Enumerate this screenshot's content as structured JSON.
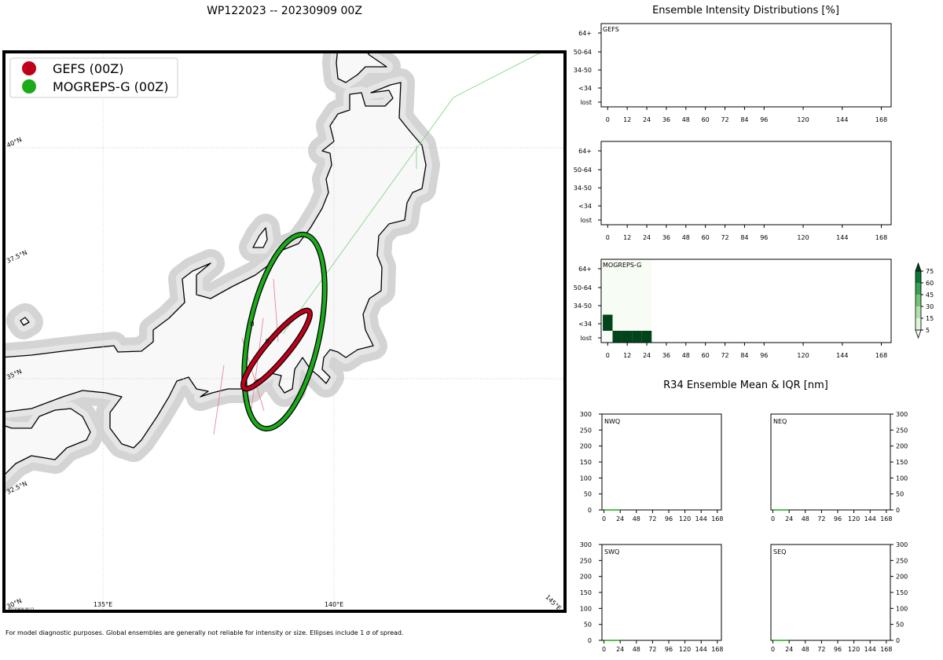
{
  "map": {
    "title": "WP122023 -- 20230909 00Z",
    "legend": [
      {
        "label": "GEFS (00Z)",
        "color": "#c0001a"
      },
      {
        "label": "MOGREPS-G (00Z)",
        "color": "#1aaa1a"
      }
    ],
    "lon_labels": [
      "135°E",
      "140°E",
      "145°E"
    ],
    "lat_labels": [
      "40°N",
      "37.5°N",
      "35°N",
      "32.5°N",
      "30°N"
    ],
    "timestamp": "20230909 08:13",
    "ellipse_labels": [
      "0",
      "0"
    ],
    "footnote": "For model diagnostic purposes. Global ensembles are generally not reliable for intensity or size. Ellipses include 1 σ of spread."
  },
  "chart_data": [
    {
      "type": "heatmap",
      "title": "Ensemble Intensity Distributions [%]",
      "panels": [
        {
          "name": "GEFS",
          "cells": []
        },
        {
          "name": "",
          "cells": []
        },
        {
          "name": "MOGREPS-G",
          "cells": [
            {
              "hour": 0,
              "row": "lost",
              "value": 1
            },
            {
              "hour": 6,
              "row": "lost",
              "value": 100
            },
            {
              "hour": 12,
              "row": "lost",
              "value": 100
            },
            {
              "hour": 18,
              "row": "lost",
              "value": 100
            },
            {
              "hour": 24,
              "row": "lost",
              "value": 100
            },
            {
              "hour": 0,
              "row": "<34",
              "value": 100
            },
            {
              "hour": 6,
              "row": "<34",
              "value": 1
            },
            {
              "hour": 12,
              "row": "<34",
              "value": 1
            },
            {
              "hour": 18,
              "row": "<34",
              "value": 1
            },
            {
              "hour": 24,
              "row": "<34",
              "value": 1
            },
            {
              "hour": 0,
              "row": "34-50",
              "value": 1
            },
            {
              "hour": 6,
              "row": "34-50",
              "value": 1
            },
            {
              "hour": 12,
              "row": "34-50",
              "value": 1
            },
            {
              "hour": 18,
              "row": "34-50",
              "value": 1
            },
            {
              "hour": 24,
              "row": "34-50",
              "value": 1
            },
            {
              "hour": 0,
              "row": "50-64",
              "value": 1
            },
            {
              "hour": 6,
              "row": "50-64",
              "value": 1
            },
            {
              "hour": 12,
              "row": "50-64",
              "value": 1
            },
            {
              "hour": 18,
              "row": "50-64",
              "value": 1
            },
            {
              "hour": 24,
              "row": "50-64",
              "value": 1
            },
            {
              "hour": 0,
              "row": "64+",
              "value": 1
            },
            {
              "hour": 6,
              "row": "64+",
              "value": 1
            },
            {
              "hour": 12,
              "row": "64+",
              "value": 1
            },
            {
              "hour": 18,
              "row": "64+",
              "value": 1
            },
            {
              "hour": 24,
              "row": "64+",
              "value": 1
            }
          ]
        }
      ],
      "rows": [
        "64+",
        "50-64",
        "34-50",
        "<34",
        "lost"
      ],
      "xticks": [
        0,
        12,
        24,
        36,
        48,
        60,
        72,
        84,
        96,
        120,
        144,
        168
      ],
      "xlim": [
        -4,
        174
      ],
      "colorbar": {
        "ticks": [
          5,
          15,
          30,
          45,
          60,
          75
        ],
        "colors": [
          "#f7fcf5",
          "#e0f3db",
          "#b2e0ab",
          "#74c476",
          "#37a055",
          "#0b7734",
          "#00441b"
        ]
      }
    },
    {
      "type": "line",
      "title": "R34 Ensemble Mean & IQR [nm]",
      "panels": [
        {
          "name": "NWQ",
          "x": [
            0,
            6,
            12,
            18,
            24
          ],
          "y": [
            0,
            0,
            0,
            0,
            0
          ],
          "color": "#1aaa1a"
        },
        {
          "name": "NEQ",
          "x": [
            0,
            6,
            12,
            18,
            24
          ],
          "y": [
            0,
            0,
            0,
            0,
            0
          ],
          "color": "#1aaa1a"
        },
        {
          "name": "SWQ",
          "x": [
            0,
            6,
            12,
            18,
            24
          ],
          "y": [
            0,
            0,
            0,
            0,
            0
          ],
          "color": "#1aaa1a"
        },
        {
          "name": "SEQ",
          "x": [
            0,
            6,
            12,
            18,
            24
          ],
          "y": [
            0,
            0,
            0,
            0,
            0
          ],
          "color": "#1aaa1a"
        }
      ],
      "xticks": [
        0,
        24,
        48,
        72,
        96,
        120,
        144,
        168
      ],
      "yticks": [
        0,
        50,
        100,
        150,
        200,
        250,
        300
      ],
      "xlim": [
        -3,
        174
      ],
      "ylim": [
        0,
        300
      ]
    }
  ]
}
